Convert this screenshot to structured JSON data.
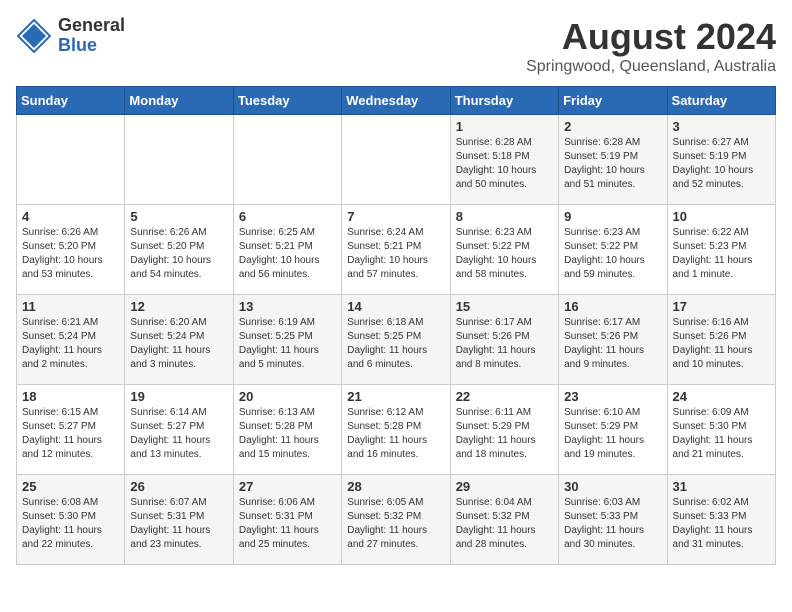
{
  "logo": {
    "general": "General",
    "blue": "Blue"
  },
  "title": "August 2024",
  "subtitle": "Springwood, Queensland, Australia",
  "days_of_week": [
    "Sunday",
    "Monday",
    "Tuesday",
    "Wednesday",
    "Thursday",
    "Friday",
    "Saturday"
  ],
  "weeks": [
    [
      {
        "day": "",
        "info": ""
      },
      {
        "day": "",
        "info": ""
      },
      {
        "day": "",
        "info": ""
      },
      {
        "day": "",
        "info": ""
      },
      {
        "day": "1",
        "info": "Sunrise: 6:28 AM\nSunset: 5:18 PM\nDaylight: 10 hours\nand 50 minutes."
      },
      {
        "day": "2",
        "info": "Sunrise: 6:28 AM\nSunset: 5:19 PM\nDaylight: 10 hours\nand 51 minutes."
      },
      {
        "day": "3",
        "info": "Sunrise: 6:27 AM\nSunset: 5:19 PM\nDaylight: 10 hours\nand 52 minutes."
      }
    ],
    [
      {
        "day": "4",
        "info": "Sunrise: 6:26 AM\nSunset: 5:20 PM\nDaylight: 10 hours\nand 53 minutes."
      },
      {
        "day": "5",
        "info": "Sunrise: 6:26 AM\nSunset: 5:20 PM\nDaylight: 10 hours\nand 54 minutes."
      },
      {
        "day": "6",
        "info": "Sunrise: 6:25 AM\nSunset: 5:21 PM\nDaylight: 10 hours\nand 56 minutes."
      },
      {
        "day": "7",
        "info": "Sunrise: 6:24 AM\nSunset: 5:21 PM\nDaylight: 10 hours\nand 57 minutes."
      },
      {
        "day": "8",
        "info": "Sunrise: 6:23 AM\nSunset: 5:22 PM\nDaylight: 10 hours\nand 58 minutes."
      },
      {
        "day": "9",
        "info": "Sunrise: 6:23 AM\nSunset: 5:22 PM\nDaylight: 10 hours\nand 59 minutes."
      },
      {
        "day": "10",
        "info": "Sunrise: 6:22 AM\nSunset: 5:23 PM\nDaylight: 11 hours\nand 1 minute."
      }
    ],
    [
      {
        "day": "11",
        "info": "Sunrise: 6:21 AM\nSunset: 5:24 PM\nDaylight: 11 hours\nand 2 minutes."
      },
      {
        "day": "12",
        "info": "Sunrise: 6:20 AM\nSunset: 5:24 PM\nDaylight: 11 hours\nand 3 minutes."
      },
      {
        "day": "13",
        "info": "Sunrise: 6:19 AM\nSunset: 5:25 PM\nDaylight: 11 hours\nand 5 minutes."
      },
      {
        "day": "14",
        "info": "Sunrise: 6:18 AM\nSunset: 5:25 PM\nDaylight: 11 hours\nand 6 minutes."
      },
      {
        "day": "15",
        "info": "Sunrise: 6:17 AM\nSunset: 5:26 PM\nDaylight: 11 hours\nand 8 minutes."
      },
      {
        "day": "16",
        "info": "Sunrise: 6:17 AM\nSunset: 5:26 PM\nDaylight: 11 hours\nand 9 minutes."
      },
      {
        "day": "17",
        "info": "Sunrise: 6:16 AM\nSunset: 5:26 PM\nDaylight: 11 hours\nand 10 minutes."
      }
    ],
    [
      {
        "day": "18",
        "info": "Sunrise: 6:15 AM\nSunset: 5:27 PM\nDaylight: 11 hours\nand 12 minutes."
      },
      {
        "day": "19",
        "info": "Sunrise: 6:14 AM\nSunset: 5:27 PM\nDaylight: 11 hours\nand 13 minutes."
      },
      {
        "day": "20",
        "info": "Sunrise: 6:13 AM\nSunset: 5:28 PM\nDaylight: 11 hours\nand 15 minutes."
      },
      {
        "day": "21",
        "info": "Sunrise: 6:12 AM\nSunset: 5:28 PM\nDaylight: 11 hours\nand 16 minutes."
      },
      {
        "day": "22",
        "info": "Sunrise: 6:11 AM\nSunset: 5:29 PM\nDaylight: 11 hours\nand 18 minutes."
      },
      {
        "day": "23",
        "info": "Sunrise: 6:10 AM\nSunset: 5:29 PM\nDaylight: 11 hours\nand 19 minutes."
      },
      {
        "day": "24",
        "info": "Sunrise: 6:09 AM\nSunset: 5:30 PM\nDaylight: 11 hours\nand 21 minutes."
      }
    ],
    [
      {
        "day": "25",
        "info": "Sunrise: 6:08 AM\nSunset: 5:30 PM\nDaylight: 11 hours\nand 22 minutes."
      },
      {
        "day": "26",
        "info": "Sunrise: 6:07 AM\nSunset: 5:31 PM\nDaylight: 11 hours\nand 23 minutes."
      },
      {
        "day": "27",
        "info": "Sunrise: 6:06 AM\nSunset: 5:31 PM\nDaylight: 11 hours\nand 25 minutes."
      },
      {
        "day": "28",
        "info": "Sunrise: 6:05 AM\nSunset: 5:32 PM\nDaylight: 11 hours\nand 27 minutes."
      },
      {
        "day": "29",
        "info": "Sunrise: 6:04 AM\nSunset: 5:32 PM\nDaylight: 11 hours\nand 28 minutes."
      },
      {
        "day": "30",
        "info": "Sunrise: 6:03 AM\nSunset: 5:33 PM\nDaylight: 11 hours\nand 30 minutes."
      },
      {
        "day": "31",
        "info": "Sunrise: 6:02 AM\nSunset: 5:33 PM\nDaylight: 11 hours\nand 31 minutes."
      }
    ]
  ]
}
